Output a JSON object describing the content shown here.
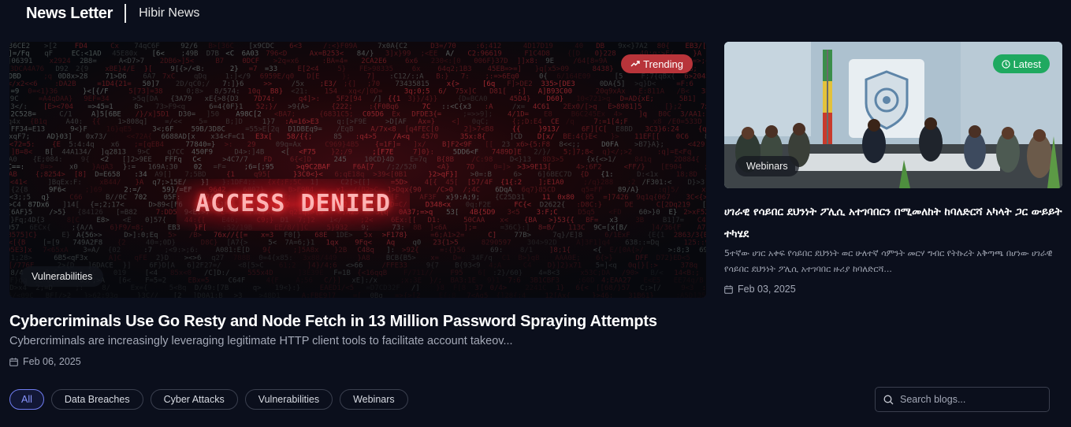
{
  "header": {
    "brand": "News Letter",
    "subbrand": "Hibir News"
  },
  "featured": {
    "badge": "Trending",
    "badge_color": "#b8343a",
    "image_text": "ACCESS DENIED",
    "category": "Vulnerabilities",
    "title": "Cybercriminals Use Go Resty and Node Fetch in 13 Million Password Spraying Attempts",
    "excerpt": "Cybercriminals are increasingly leveraging legitimate HTTP client tools to facilitate account takeov...",
    "date": "Feb 06, 2025"
  },
  "latest": {
    "badge": "Latest",
    "badge_color": "#1fa960",
    "category": "Webinars",
    "title": "ሀገራዊ የሳይበር ደህንነት ፖሊሲ አተገባበርን በሚመለከት ከባለድርሻ አካላት ጋር ውይይት ተካሄደ",
    "excerpt": "5ተኛው ሀገር አቀፍ የሳይበር ደህንነት ወር ሁለተኛ ሳምንት መርሃ ግብር የትኩረት አቅጣጫ በሆነው ሀገራዊ የሳይበር ደህንነት ፖሊሲ አተገባበር ዙሪያ ከባለድርሻ...",
    "date": "Feb 03, 2025"
  },
  "filters": [
    "All",
    "Data Breaches",
    "Cyber Attacks",
    "Vulnerabilities",
    "Webinars"
  ],
  "active_filter": "All",
  "search": {
    "placeholder": "Search blogs..."
  },
  "colors": {
    "background": "#0b0f1c",
    "accent": "#6f7cf0"
  }
}
